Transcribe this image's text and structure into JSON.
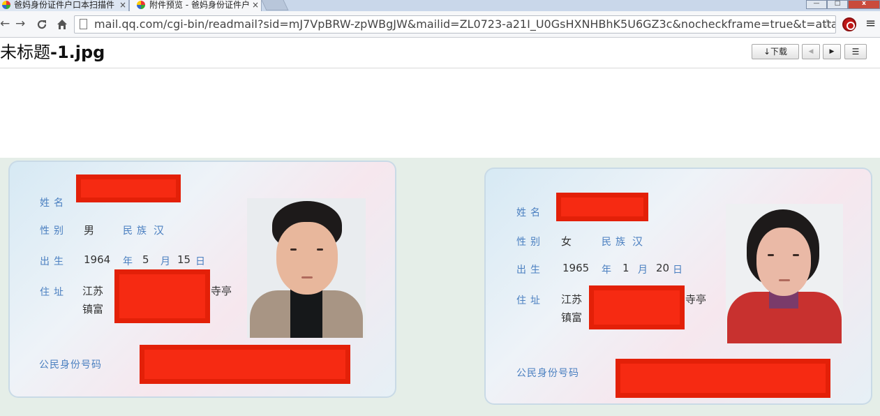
{
  "browser": {
    "tabs": [
      {
        "title": "爸妈身份证件户口本扫描件",
        "active": false
      },
      {
        "title": "附件预览 - 爸妈身份证件户",
        "active": true
      }
    ],
    "tab_close_glyph": "×",
    "window_controls": {
      "minimize": "—",
      "maximize": "□",
      "close": "x"
    },
    "url": "mail.qq.com/cgi-bin/readmail?sid=mJ7VpBRW-zpWBgJW&mailid=ZL0723-a21I_U0GsHXNHBhK5U6GZ3c&nocheckframe=true&t=attach",
    "icons": {
      "back": "back-arrow-icon",
      "forward": "forward-arrow-icon",
      "reload": "reload-icon",
      "home": "home-icon",
      "page": "page-icon",
      "bookmark": "star-icon",
      "extension": "adblock-icon",
      "menu": "hamburger-menu-icon"
    }
  },
  "header": {
    "title_prefix": "未标题",
    "title_suffix": "-1.jpg",
    "download_label": "↓下载",
    "prev_glyph": "◀",
    "next_glyph": "▶",
    "list_glyph": "☰"
  },
  "image": {
    "card1": {
      "name_label": "姓名",
      "sex_label": "性别",
      "sex_value": "男",
      "ethnicity_label": "民族",
      "ethnicity_value": "汉",
      "birth_label": "出生",
      "birth_year": "1964",
      "birth_month": "5",
      "birth_day": "15",
      "address_label": "住址",
      "address_line1_start": "江苏",
      "address_line1_end": "寺亭",
      "address_line2": "镇富",
      "id_label": "公民身份号码"
    },
    "card2": {
      "name_label": "姓名",
      "sex_label": "性别",
      "sex_value": "女",
      "ethnicity_label": "民族",
      "ethnicity_value": "汉",
      "birth_label": "出生",
      "birth_year": "1965",
      "birth_month": "1",
      "birth_day": "20",
      "address_label": "住址",
      "address_line1_start": "江苏",
      "address_line1_end": "寺亭",
      "address_line2": "镇富",
      "id_label": "公民身份号码"
    },
    "date_units": {
      "year": "年",
      "month": "月",
      "day": "日"
    },
    "redaction_color": "#f62a12"
  },
  "colors": {
    "card_text_label": "#4a7fc0",
    "viewer_bg": "#e5eee8"
  }
}
